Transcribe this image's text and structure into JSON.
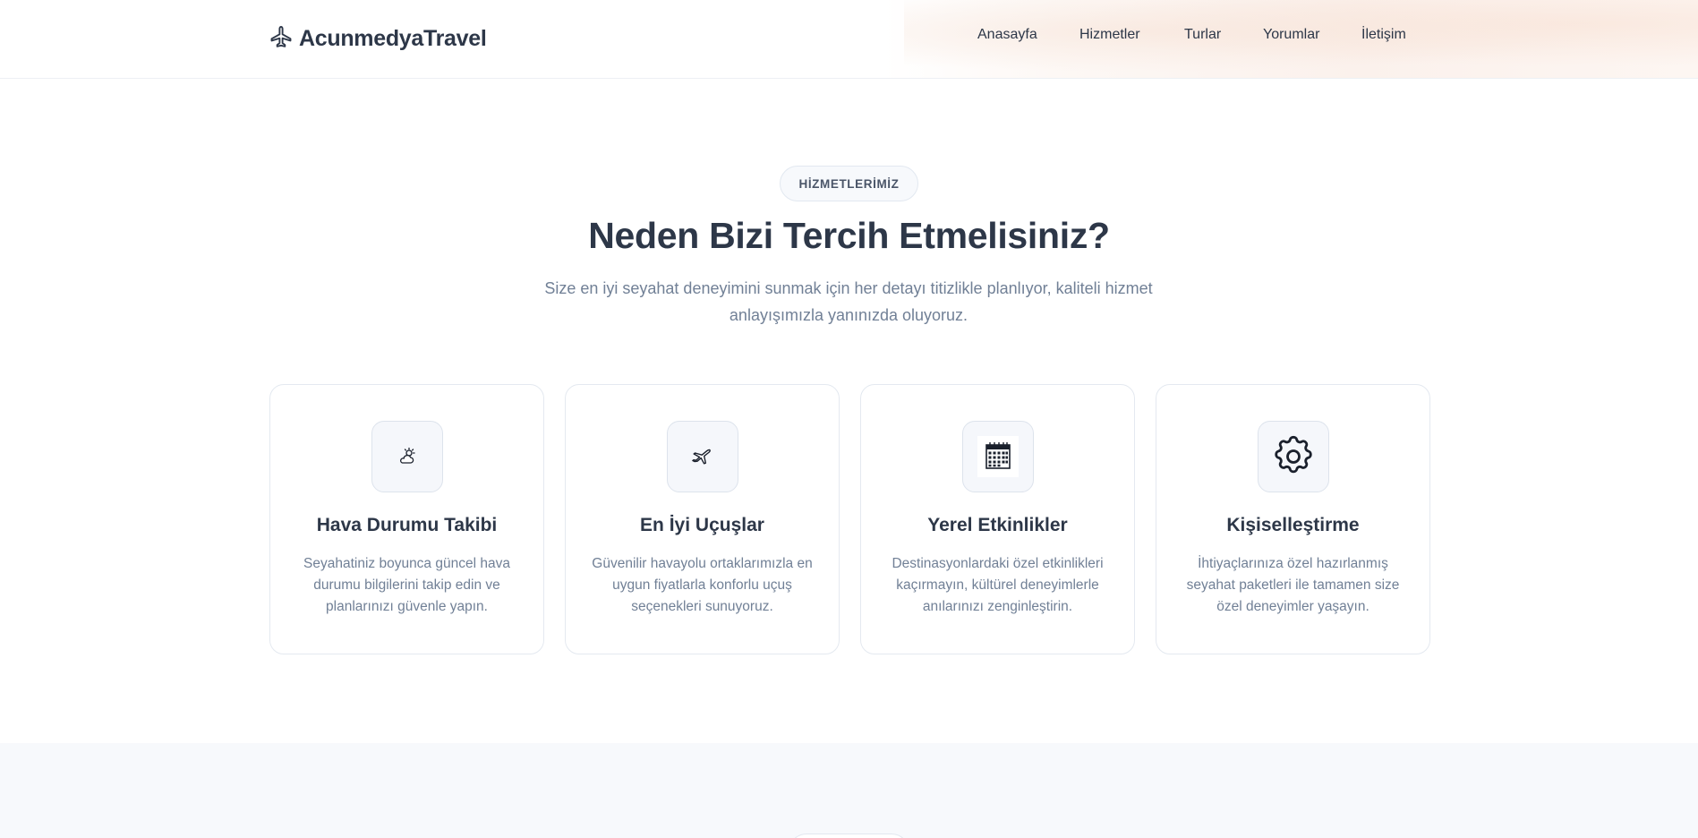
{
  "brand": {
    "name": "AcunmedyaTravel",
    "icon": "airplane-icon"
  },
  "nav": {
    "items": [
      {
        "label": "Anasayfa"
      },
      {
        "label": "Hizmetler"
      },
      {
        "label": "Turlar"
      },
      {
        "label": "Yorumlar"
      },
      {
        "label": "İletişim"
      }
    ]
  },
  "services": {
    "badge": "HİZMETLERİMİZ",
    "title": "Neden Bizi Tercih Etmelisiniz?",
    "subtitle": "Size en iyi seyahat deneyimini sunmak için her detayı titizlikle planlıyor, kaliteli hizmet anlayışımızla yanınızda oluyoruz.",
    "cards": [
      {
        "icon": "sun-behind-cloud-icon",
        "title": "Hava Durumu Takibi",
        "description": "Seyahatiniz boyunca güncel hava durumu bilgilerini takip edin ve planlarınızı güvenle yapın."
      },
      {
        "icon": "airplane-icon",
        "title": "En İyi Uçuşlar",
        "description": "Güvenilir havayolu ortaklarımızla en uygun fiyatlarla konforlu uçuş seçenekleri sunuyoruz."
      },
      {
        "icon": "calendar-icon",
        "title": "Yerel Etkinlikler",
        "description": "Destinasyonlardaki özel etkinlikleri kaçırmayın, kültürel deneyimlerle anılarınızı zenginleştirin."
      },
      {
        "icon": "gear-icon",
        "title": "Kişiselleştirme",
        "description": "İhtiyaçlarınıza özel hazırlanmış seyahat paketleri ile tamamen size özel deneyimler yaşayın."
      }
    ]
  },
  "colors": {
    "heading": "#2d3748",
    "body_text": "#718096",
    "card_border": "#e4e9f0",
    "section_alt_bg": "#f7f9fc"
  }
}
